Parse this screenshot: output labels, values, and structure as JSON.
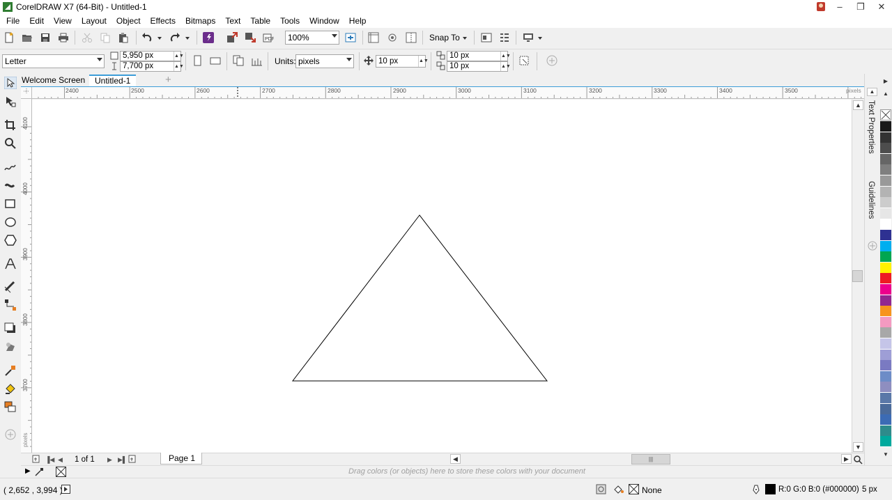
{
  "window": {
    "title": "CorelDRAW X7 (64-Bit) - Untitled-1",
    "controls": [
      "–",
      "❐",
      "✕"
    ]
  },
  "menu": [
    "File",
    "Edit",
    "View",
    "Layout",
    "Object",
    "Effects",
    "Bitmaps",
    "Text",
    "Table",
    "Tools",
    "Window",
    "Help"
  ],
  "standard_toolbar": {
    "zoom_value": "100%",
    "snap_to_label": "Snap To"
  },
  "property_bar": {
    "page_size": "Letter",
    "width": "5,950 px",
    "height": "7,700 px",
    "units_label": "Units:",
    "units_value": "pixels",
    "nudge": "10 px",
    "dup_x": "10 px",
    "dup_y": "10 px"
  },
  "doc_tabs": [
    "Welcome Screen",
    "Untitled-1"
  ],
  "rulers": {
    "unit_label": "pixels",
    "h_ticks": [
      "2400",
      "2500",
      "2600",
      "2700",
      "2800",
      "2900",
      "3000",
      "3100",
      "3200",
      "3300",
      "3400",
      "3500"
    ],
    "v_ticks": [
      "4100",
      "4000",
      "3900",
      "3800",
      "3700"
    ]
  },
  "page_nav": {
    "counter": "1 of 1",
    "page_tab": "Page 1"
  },
  "docker_tabs": [
    "Text Properties",
    "Guidelines"
  ],
  "palette_colors": [
    "#1a1a1a",
    "#333333",
    "#4d4d4d",
    "#666666",
    "#7f7f7f",
    "#999999",
    "#b3b3b3",
    "#cccccc",
    "#e6e6e6",
    "#ffffff",
    "#2e3192",
    "#00aeef",
    "#00a651",
    "#fff200",
    "#ed1c24",
    "#ec008c",
    "#92278f",
    "#f7941d",
    "#f49ac1",
    "#a8a8a8",
    "#c5c5e8",
    "#9e9ed6",
    "#7a7ac2",
    "#6d8cc7",
    "#8e8ec0",
    "#5a78a8",
    "#4a6a9a",
    "#3c6bb4",
    "#2e8b8b",
    "#00a99d"
  ],
  "document_palette_hint": "Drag colors (or objects) here to store these colors with your document",
  "status": {
    "cursor_coords": "( 2,652 , 3,994 )",
    "fill_label": "None",
    "outline_color": "R:0 G:0 B:0 (#000000)",
    "outline_width": "5 px"
  }
}
